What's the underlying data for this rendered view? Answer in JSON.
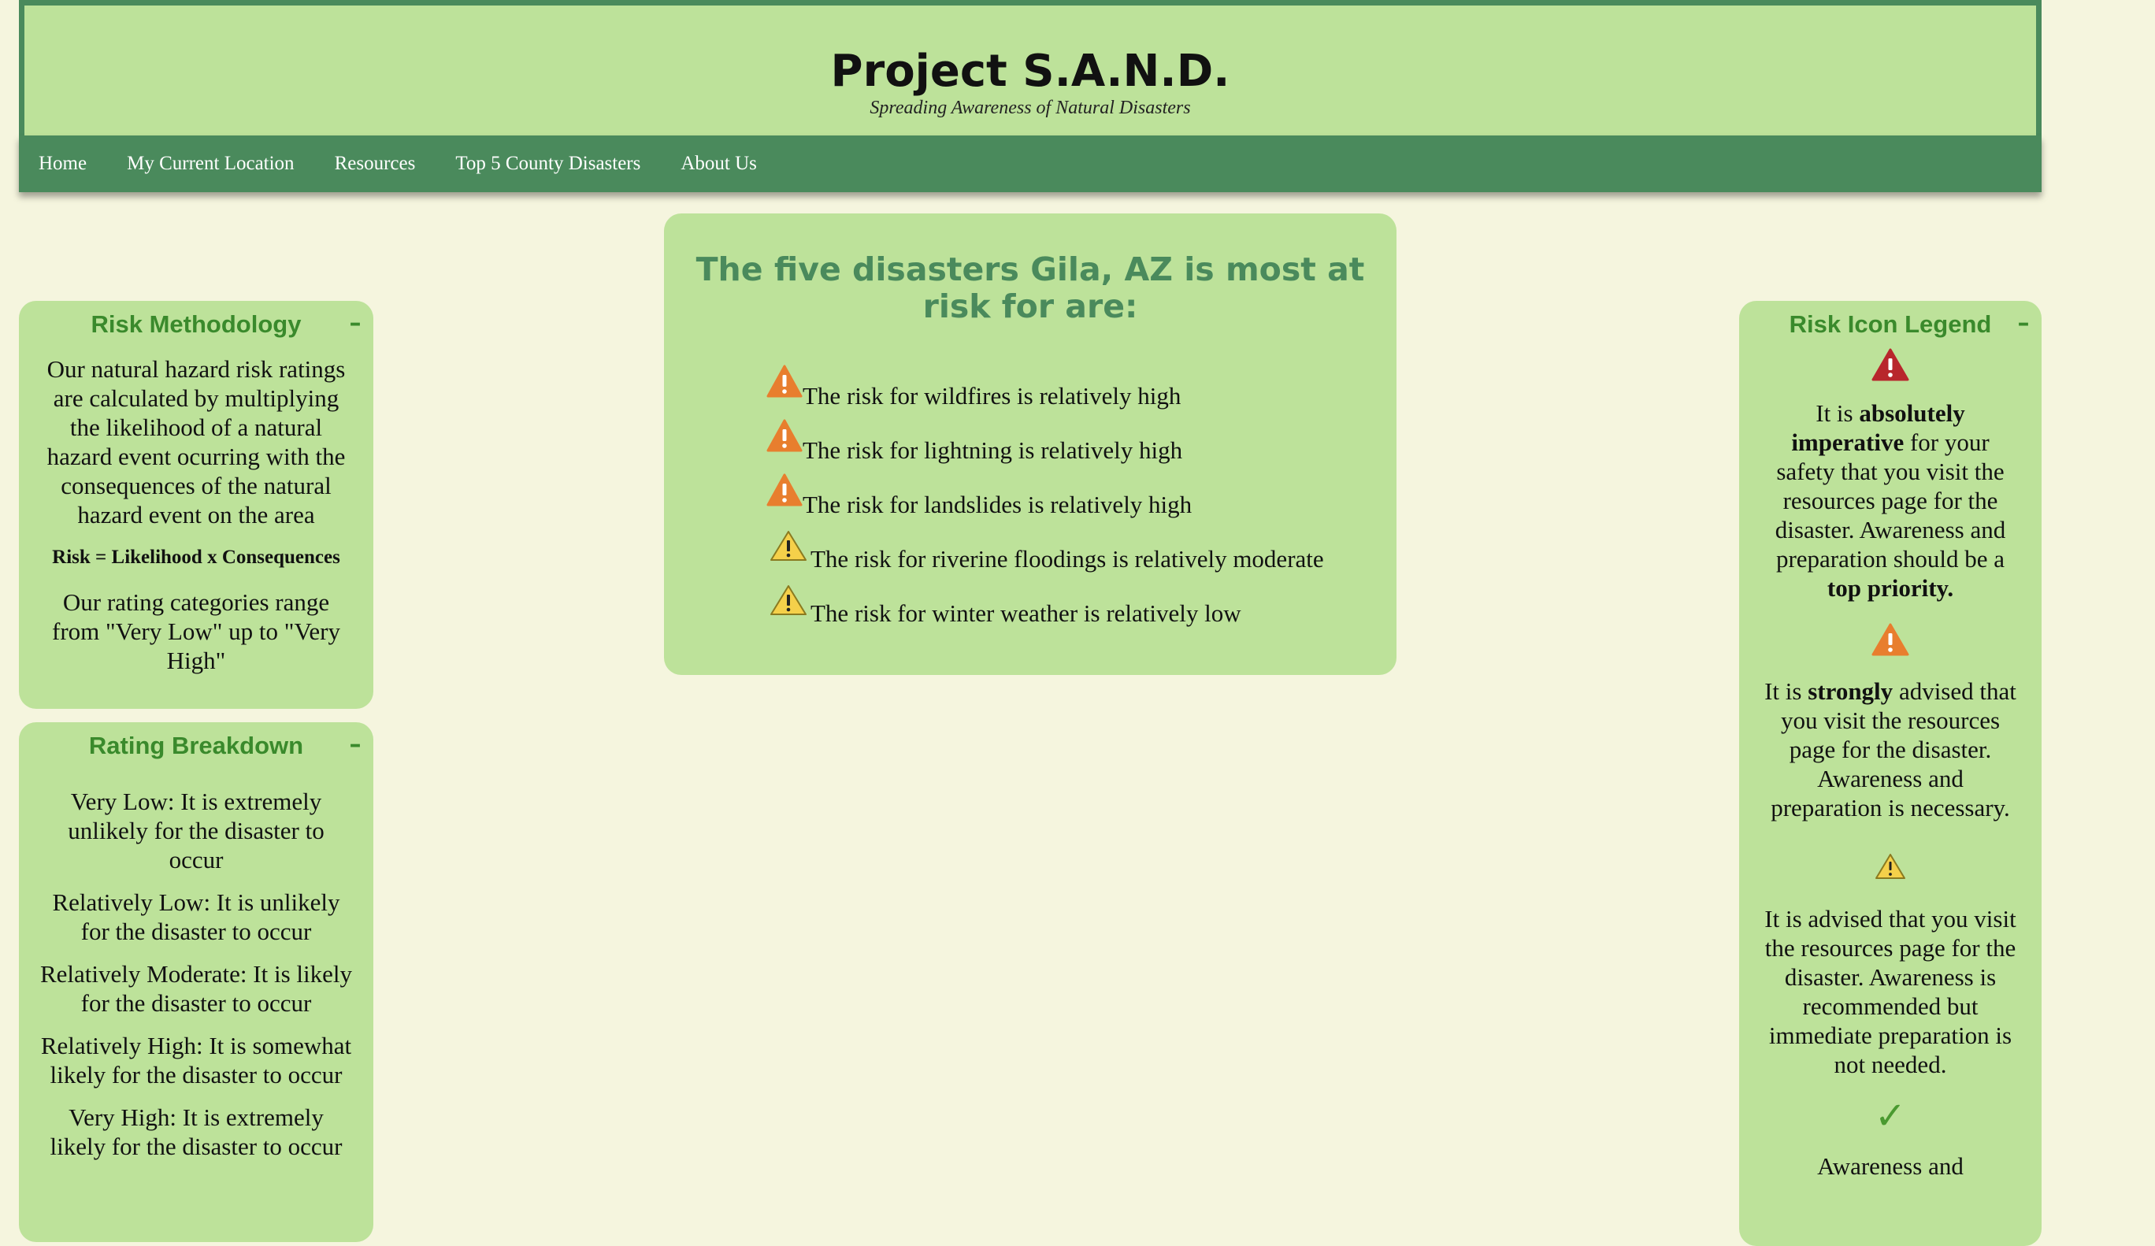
{
  "header": {
    "title": "Project S.A.N.D.",
    "subtitle": "Spreading Awareness of Natural Disasters"
  },
  "nav": {
    "items": [
      "Home",
      "My Current Location",
      "Resources",
      "Top 5 County Disasters",
      "About Us"
    ]
  },
  "main": {
    "heading": "The five disasters Gila, AZ is most at risk for are:",
    "risks": [
      {
        "text": "The risk for wildfires is relatively high",
        "icon": "orange-warning-icon"
      },
      {
        "text": "The risk for lightning is relatively high",
        "icon": "orange-warning-icon"
      },
      {
        "text": "The risk for landslides is relatively high",
        "icon": "orange-warning-icon"
      },
      {
        "text": "The risk for riverine floodings is relatively moderate",
        "icon": "yellow-warning-icon"
      },
      {
        "text": "The risk for winter weather is relatively low",
        "icon": "yellow-warning-icon"
      }
    ]
  },
  "methodology": {
    "title": "Risk Methodology",
    "collapse_symbol": "–",
    "description": "Our natural hazard risk ratings are calculated by multiplying the likelihood of a natural hazard event ocurring with the consequences of the natural hazard event on the area",
    "formula": "Risk = Likelihood x Consequences",
    "range": "Our rating categories range from \"Very Low\" up to \"Very High\""
  },
  "breakdown": {
    "title": "Rating Breakdown",
    "collapse_symbol": "–",
    "items": [
      "Very Low: It is extremely unlikely for the disaster to occur",
      "Relatively Low: It is unlikely for the disaster to occur",
      "Relatively Moderate: It is likely for the disaster to occur",
      "Relatively High: It is somewhat likely for the disaster to occur",
      "Very High: It is extremely likely for the disaster to occur"
    ]
  },
  "legend": {
    "title": "Risk Icon Legend",
    "collapse_symbol": "–",
    "red": {
      "pre": "It is ",
      "bold1": "absolutely imperative",
      "mid": " for your safety that you visit the resources page for the disaster. Awareness and preparation should be a ",
      "bold2": "top priority."
    },
    "orange": {
      "pre": "It is ",
      "bold": "strongly",
      "post": " advised that you visit the resources page for the disaster. Awareness and preparation is necessary."
    },
    "yellow": "It is advised that you visit the resources page for the disaster. Awareness is recommended but immediate preparation is not needed.",
    "check": "Awareness and",
    "check_symbol": "✓",
    "colors": {
      "red": "#b8262c",
      "orange": "#e87e2e",
      "yellow": "#f5d04a",
      "green": "#4a9a30"
    }
  }
}
